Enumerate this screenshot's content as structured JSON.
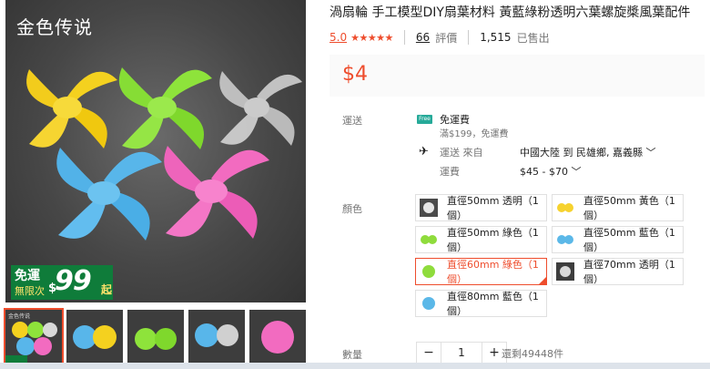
{
  "gallery": {
    "watermark": "金色传说",
    "promo": {
      "line1": "免運",
      "line2": "無限次",
      "currency": "$",
      "amount": "99",
      "suffix": "起"
    },
    "thumbnails": [
      "金色传说",
      "",
      "",
      "",
      ""
    ]
  },
  "product": {
    "title": "渦扇輪 手工模型DIY扇葉材料 黃藍綠粉透明六葉螺旋槳風葉配件",
    "rating": "5.0",
    "stars": "★★★★★",
    "reviews_count": "66",
    "reviews_label": "評價",
    "sold_count": "1,515",
    "sold_label": "已售出",
    "price": "$4"
  },
  "shipping": {
    "label": "運送",
    "free_icon": "Free",
    "free_label": "免運費",
    "free_sub": "滿$199，免運費",
    "ship_to_label": "運送 來自",
    "ship_to_value": "中國大陸 到  民雄鄉, 嘉義縣 ﹀",
    "fee_label": "運費",
    "fee_value": "$45 - $70 ﹀"
  },
  "colors": {
    "label": "顏色",
    "options": [
      {
        "label": "直徑50mm 透明（1個）",
        "selected": false,
        "swatch": "#e6e6e6"
      },
      {
        "label": "直徑50mm 黃色（1個）",
        "selected": false,
        "swatch": "#f6d22e"
      },
      {
        "label": "直徑50mm 綠色（1個）",
        "selected": false,
        "swatch": "#8fdc3c"
      },
      {
        "label": "直徑50mm 藍色（1個）",
        "selected": false,
        "swatch": "#5bb8e8"
      },
      {
        "label": "直徑60mm 綠色（1個）",
        "selected": true,
        "swatch": "#8fdc3c"
      },
      {
        "label": "直徑70mm 透明（1個）",
        "selected": false,
        "swatch": "#d9d9d9"
      },
      {
        "label": "直徑80mm 藍色（1個）",
        "selected": false,
        "swatch": "#5bb8e8"
      }
    ]
  },
  "quantity": {
    "label": "數量",
    "minus": "−",
    "value": "1",
    "plus": "+",
    "stock": "還剩49448件"
  }
}
